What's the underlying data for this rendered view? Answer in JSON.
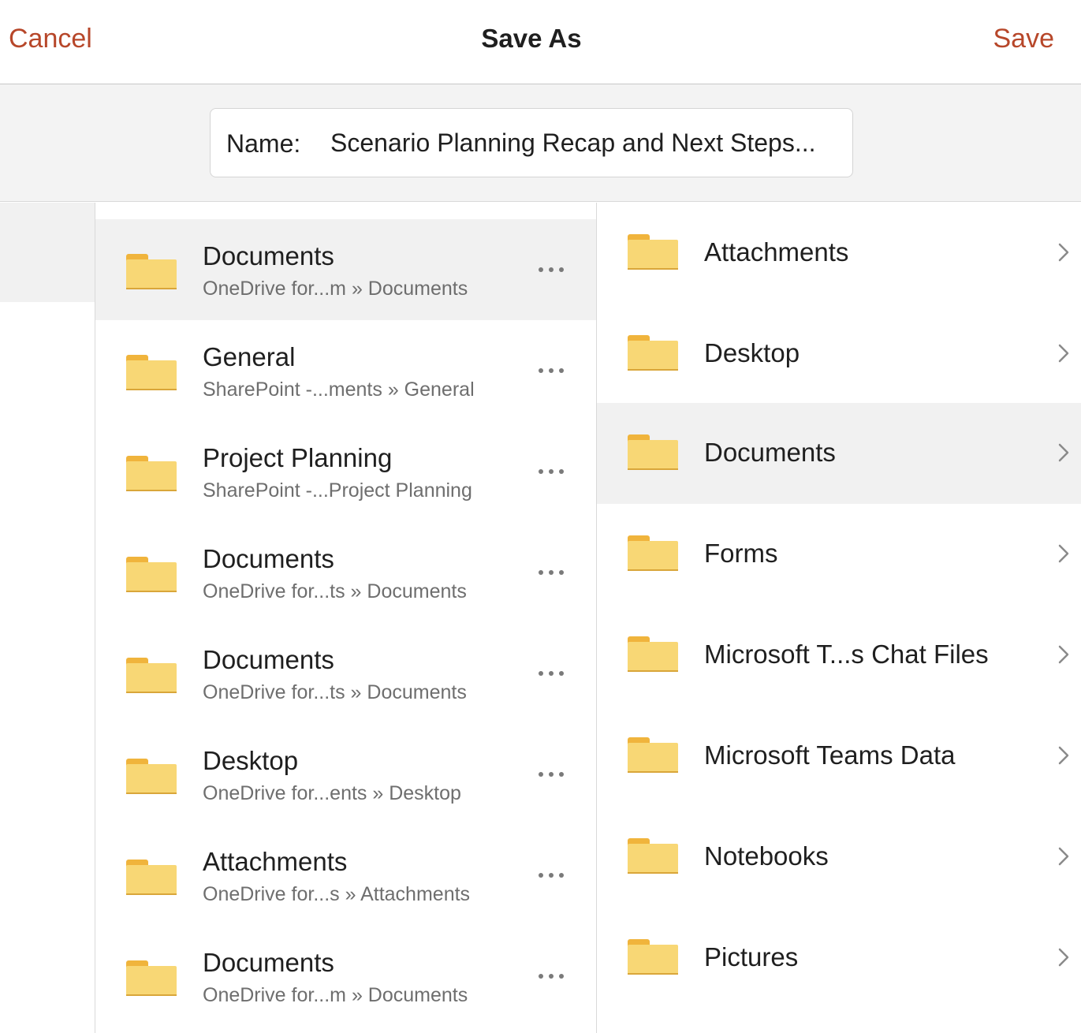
{
  "header": {
    "cancel_label": "Cancel",
    "title": "Save As",
    "save_label": "Save"
  },
  "name_field": {
    "label": "Name:",
    "value": "Scenario Planning Recap and Next Steps..."
  },
  "icons": {
    "folder": "folder-icon",
    "more": "more-options-icon",
    "chevron": "chevron-right-icon"
  },
  "colors": {
    "accent": "#b7472a",
    "folder_fill": "#f8d775",
    "folder_tab": "#f0b43c",
    "selected_row": "#f1f1f1"
  },
  "recent_locations": [
    {
      "name": "Documents",
      "path": "OneDrive for...m » Documents",
      "selected": true
    },
    {
      "name": "General",
      "path": "SharePoint -...ments » General",
      "selected": false
    },
    {
      "name": "Project Planning",
      "path": "SharePoint -...Project Planning",
      "selected": false
    },
    {
      "name": "Documents",
      "path": "OneDrive for...ts » Documents",
      "selected": false
    },
    {
      "name": "Documents",
      "path": "OneDrive for...ts » Documents",
      "selected": false
    },
    {
      "name": "Desktop",
      "path": "OneDrive for...ents » Desktop",
      "selected": false
    },
    {
      "name": "Attachments",
      "path": "OneDrive for...s » Attachments",
      "selected": false
    },
    {
      "name": "Documents",
      "path": "OneDrive for...m » Documents",
      "selected": false
    }
  ],
  "folders": [
    {
      "name": "Attachments",
      "selected": false
    },
    {
      "name": "Desktop",
      "selected": false
    },
    {
      "name": "Documents",
      "selected": true
    },
    {
      "name": "Forms",
      "selected": false
    },
    {
      "name": "Microsoft T...s Chat Files",
      "selected": false
    },
    {
      "name": "Microsoft Teams Data",
      "selected": false
    },
    {
      "name": "Notebooks",
      "selected": false
    },
    {
      "name": "Pictures",
      "selected": false
    }
  ]
}
